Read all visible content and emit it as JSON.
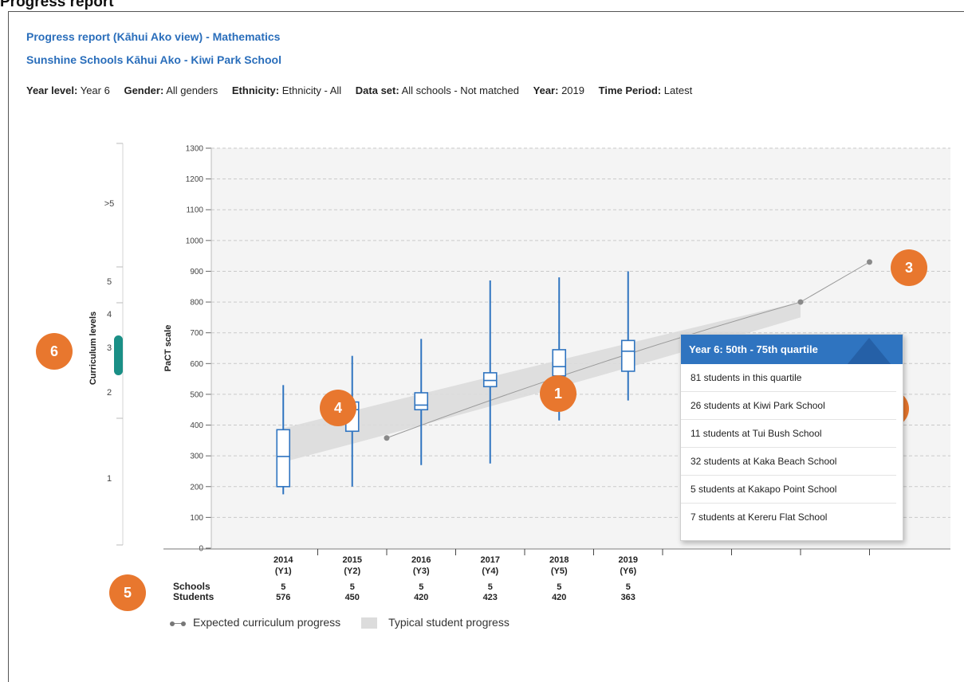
{
  "page": {
    "heading": "Progress report",
    "title": "Progress report (Kāhui Ako view) - Mathematics",
    "subtitle": "Sunshine Schools Kāhui Ako - Kiwi Park School"
  },
  "filters": [
    {
      "label": "Year level:",
      "value": "Year 6"
    },
    {
      "label": "Gender:",
      "value": "All genders"
    },
    {
      "label": "Ethnicity:",
      "value": "Ethnicity - All"
    },
    {
      "label": "Data set:",
      "value": "All schools - Not matched"
    },
    {
      "label": "Year:",
      "value": "2019"
    },
    {
      "label": "Time Period:",
      "value": "Latest"
    }
  ],
  "curriculum_levels": {
    "title": "Curriculum levels",
    "labels": [
      ">5",
      "5",
      "4",
      "3",
      "2",
      "1"
    ],
    "highlight_level": "3",
    "highlight_color": "#1a8f86"
  },
  "colors": {
    "box": "#2f74c0",
    "expected_line": "#9a9a9a",
    "band": "#dcdcdc",
    "badge": "#e8772e",
    "tooltip_header": "#2f74c0",
    "plot_bg": "#f4f4f4"
  },
  "chart_data": {
    "type": "box",
    "ylabel": "PaCT scale",
    "ylim": [
      0,
      1300
    ],
    "yticks": [
      0,
      100,
      200,
      300,
      400,
      500,
      600,
      700,
      800,
      900,
      1000,
      1100,
      1200,
      1300
    ],
    "grid": true,
    "categories": [
      {
        "year": "2014",
        "yl": "(Y1)"
      },
      {
        "year": "2015",
        "yl": "(Y2)"
      },
      {
        "year": "2016",
        "yl": "(Y3)"
      },
      {
        "year": "2017",
        "yl": "(Y4)"
      },
      {
        "year": "2018",
        "yl": "(Y5)"
      },
      {
        "year": "2019",
        "yl": "(Y6)"
      }
    ],
    "boxes": [
      {
        "min": 175,
        "q1": 200,
        "median": 298,
        "q3": 385,
        "max": 530
      },
      {
        "min": 200,
        "q1": 380,
        "median": 450,
        "q3": 475,
        "max": 625
      },
      {
        "min": 270,
        "q1": 450,
        "median": 465,
        "q3": 505,
        "max": 680
      },
      {
        "min": 275,
        "q1": 525,
        "median": 545,
        "q3": 570,
        "max": 870
      },
      {
        "min": 415,
        "q1": 560,
        "median": 590,
        "q3": 645,
        "max": 880
      },
      {
        "min": 480,
        "q1": 575,
        "median": 640,
        "q3": 675,
        "max": 900
      }
    ],
    "expected_curriculum_progress": [
      {
        "pos": 2,
        "value": 358
      },
      {
        "pos": 8,
        "value": 800
      },
      {
        "pos": 9,
        "value": 930
      }
    ],
    "typical_student_progress": {
      "x_from": 0.5,
      "x_to": 8.0,
      "upper": [
        390,
        800
      ],
      "lower": [
        280,
        750
      ],
      "upper_mid": 600,
      "lower_mid": 500
    },
    "row_labels": {
      "schools": "Schools",
      "students": "Students"
    },
    "schools": [
      "5",
      "5",
      "5",
      "5",
      "5",
      "5"
    ],
    "students": [
      "576",
      "450",
      "420",
      "423",
      "420",
      "363"
    ],
    "legend": {
      "expected": "Expected curriculum progress",
      "typical": "Typical student progress"
    },
    "tooltip": {
      "header": "Year 6: 50th - 75th quartile",
      "rows": [
        "81 students in this quartile",
        "26 students at Kiwi Park School",
        "11 students at Tui Bush School",
        "32 students at Kaka Beach School",
        "5 students at Kakapo Point School",
        "7 students at Kereru Flat School"
      ]
    }
  },
  "annotations": {
    "badges": [
      "1",
      "2",
      "3",
      "4",
      "5",
      "6"
    ]
  }
}
